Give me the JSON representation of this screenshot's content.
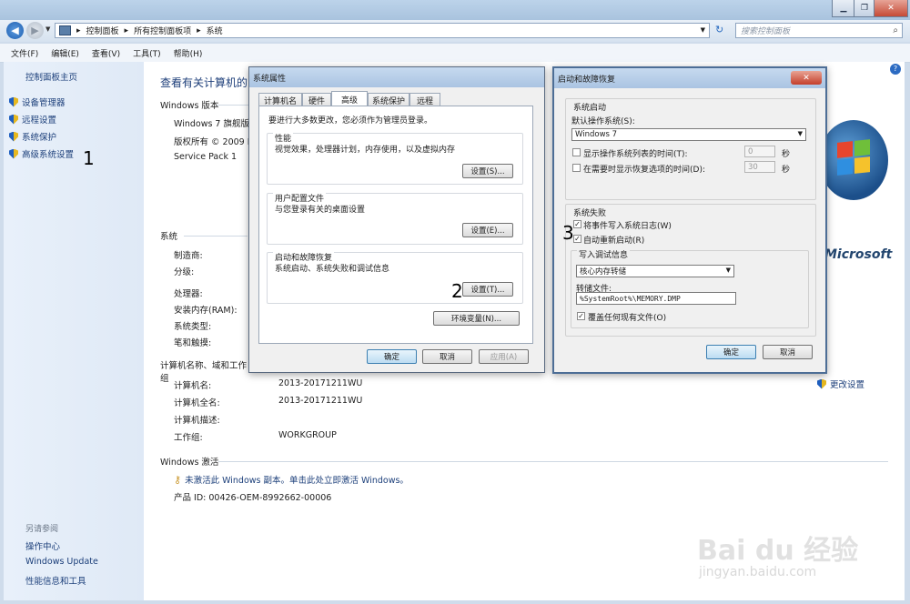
{
  "address": {
    "crumbs": [
      "控制面板",
      "所有控制面板项",
      "系统"
    ],
    "search_placeholder": "搜索控制面板"
  },
  "menu": [
    "文件(F)",
    "编辑(E)",
    "查看(V)",
    "工具(T)",
    "帮助(H)"
  ],
  "sidebar": {
    "home": "控制面板主页",
    "items": [
      "设备管理器",
      "远程设置",
      "系统保护",
      "高级系统设置"
    ],
    "see_also_title": "另请参阅",
    "see_also": [
      "操作中心",
      "Windows Update",
      "性能信息和工具"
    ]
  },
  "main": {
    "page_title": "查看有关计算机的",
    "edition_title": "Windows 版本",
    "edition": "Windows 7 旗舰版",
    "copyright": "版权所有 © 2009 M",
    "service_pack": "Service Pack 1",
    "system_title": "系统",
    "system_labels": [
      "制造商:",
      "分级:",
      "处理器:",
      "安装内存(RAM):",
      "系统类型:",
      "笔和触摸:"
    ],
    "computer_title": "计算机名称、域和工作组",
    "computer_labels": [
      "计算机名:",
      "计算机全名:",
      "计算机描述:",
      "工作组:"
    ],
    "computer_values": [
      "2013-20171211WU",
      "2013-20171211WU",
      "",
      "WORKGROUP"
    ],
    "change_settings": "更改设置",
    "activation_title": "Windows 激活",
    "activation_link": "未激活此 Windows 副本。单击此处立即激活 Windows。",
    "product_id": "产品 ID: 00426-OEM-8992662-00006",
    "logo_text": "Microsoft"
  },
  "annotations": [
    "1",
    "2",
    "3"
  ],
  "sysprops": {
    "title": "系统属性",
    "tabs": [
      "计算机名",
      "硬件",
      "高级",
      "系统保护",
      "远程"
    ],
    "admin_note": "要进行大多数更改，您必须作为管理员登录。",
    "perf_title": "性能",
    "perf_desc": "视觉效果，处理器计划，内存使用，以及虚拟内存",
    "profile_title": "用户配置文件",
    "profile_desc": "与您登录有关的桌面设置",
    "startup_title": "启动和故障恢复",
    "startup_desc": "系统启动、系统失败和调试信息",
    "settings_btn1": "设置(S)...",
    "settings_btn2": "设置(E)...",
    "settings_btn3": "设置(T)...",
    "env_btn": "环境变量(N)...",
    "ok": "确定",
    "cancel": "取消",
    "apply": "应用(A)"
  },
  "startup": {
    "title": "启动和故障恢复",
    "sys_start_title": "系统启动",
    "default_os_label": "默认操作系统(S):",
    "default_os_value": "Windows 7",
    "show_list_label": "显示操作系统列表的时间(T):",
    "show_list_value": "0",
    "show_recovery_label": "在需要时显示恢复选项的时间(D):",
    "show_recovery_value": "30",
    "seconds": "秒",
    "failure_title": "系统失败",
    "write_log": "将事件写入系统日志(W)",
    "auto_restart": "自动重新启动(R)",
    "debug_title": "写入调试信息",
    "debug_value": "核心内存转储",
    "dump_label": "转储文件:",
    "dump_value": "%SystemRoot%\\MEMORY.DMP",
    "overwrite": "覆盖任何现有文件(O)",
    "ok": "确定",
    "cancel": "取消"
  },
  "watermark": {
    "brand": "Bai du 经验",
    "url": "jingyan.baidu.com"
  }
}
